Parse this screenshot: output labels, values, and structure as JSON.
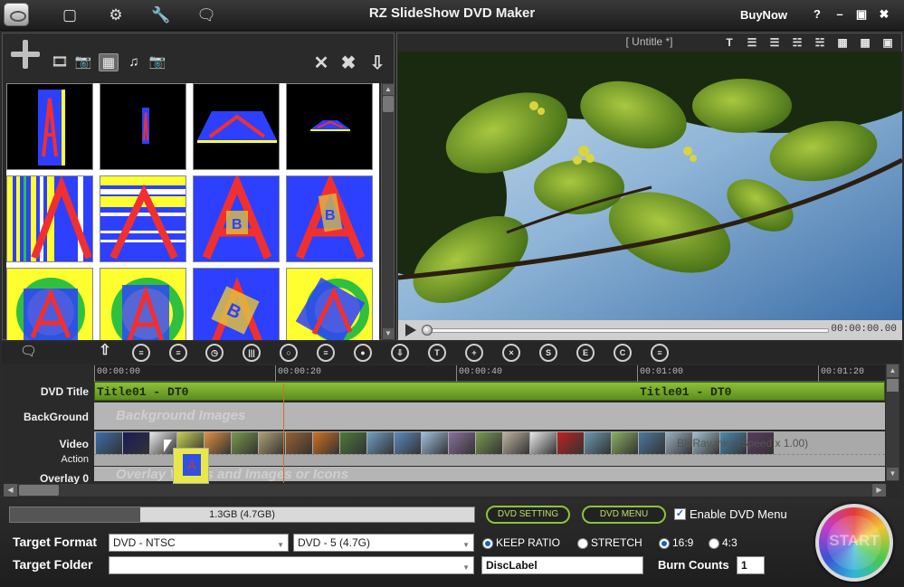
{
  "titlebar": {
    "app_title": "RZ SlideShow DVD Maker",
    "buy_now": "BuyNow",
    "help": "?",
    "minimize": "–",
    "maximize": "▣",
    "close": "✖",
    "icons": [
      "open-file-icon",
      "settings-gears-icon",
      "wrench-icon",
      "speech-bubble-icon"
    ]
  },
  "left_panel": {
    "tabs": [
      "video-icon",
      "camera-icon",
      "transition-icon",
      "music-note-icon",
      "overlay-camera-icon"
    ],
    "active_tab": "transition-icon",
    "actions": [
      "remove-icon",
      "remove-all-icon",
      "download-arrow-icon"
    ]
  },
  "right_panel": {
    "doc_title": "[ Untitle *]",
    "align_tools": [
      "text-icon",
      "align-left-icon",
      "align-right-icon",
      "align-top-icon",
      "align-bottom-icon",
      "center-h-icon",
      "center-v-icon",
      "fit-icon"
    ],
    "time": "00:00:00.00",
    "seek_position": 0
  },
  "timeline": {
    "ruler": [
      "00:00:00",
      "00:00:20",
      "00:00:40",
      "00:01:00",
      "00:01:20"
    ],
    "tracks": {
      "dvd_title": "DVD Title",
      "background": "BackGround",
      "video": "Video",
      "action": "Action",
      "overlay": "Overlay 0"
    },
    "title_clips": [
      "Title01 - DT0",
      "Title01 - DT0"
    ],
    "bg_placeholder": "Background Images",
    "overlay_placeholder": "Overlay Videos and Images or Icons",
    "video_text": "BluRay.mkv  (Speed x 1.00)",
    "toolbar_icons": [
      "speech-icon",
      "up-arrow-icon",
      "filter-icon",
      "filter-remove-icon",
      "clock-icon",
      "bars-icon",
      "zoom-remove-icon",
      "list-remove-icon",
      "record-icon",
      "down-icon",
      "text-circle-icon",
      "crop-icon",
      "crop-remove-icon",
      "s-icon",
      "e-icon",
      "c-icon",
      "clear-icon"
    ]
  },
  "bottom": {
    "disc_usage": "1.3GB (4.7GB)",
    "disc_fill": 0.28,
    "dvd_setting": "DVD SETTING",
    "dvd_menu": "DVD MENU",
    "enable_menu": "Enable DVD Menu",
    "enable_menu_checked": true,
    "target_format_label": "Target Format",
    "target_format": "DVD - NTSC",
    "disc_type": "DVD - 5 (4.7G)",
    "keep_ratio": "KEEP RATIO",
    "stretch": "STRETCH",
    "ratio_169": "16:9",
    "ratio_43": "4:3",
    "target_folder_label": "Target Folder",
    "target_folder": "",
    "disc_label": "DiscLabel",
    "burn_counts_label": "Burn Counts",
    "burn_counts": "1",
    "start": "START"
  }
}
